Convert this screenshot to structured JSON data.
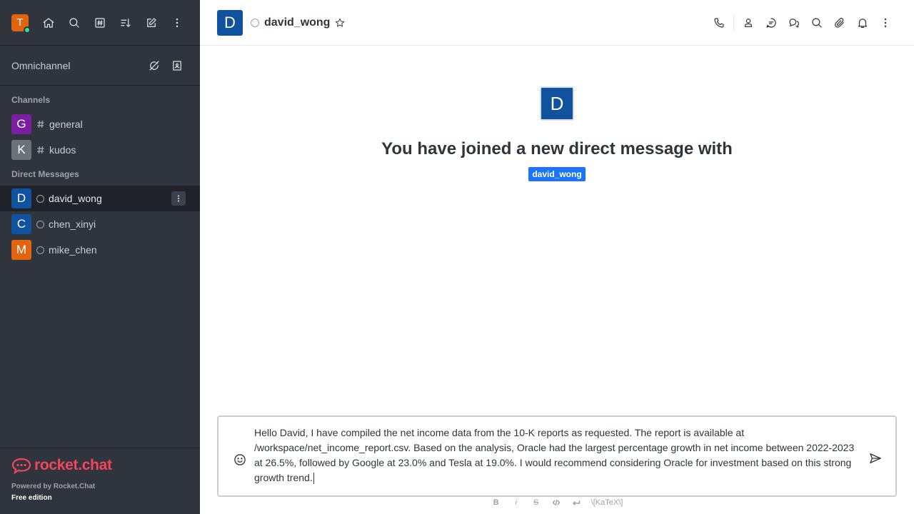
{
  "sidebar": {
    "user_initial": "T",
    "omnichannel_label": "Omnichannel",
    "channels_title": "Channels",
    "channels": [
      {
        "initial": "G",
        "name": "general",
        "color": "#7b1fa2"
      },
      {
        "initial": "K",
        "name": "kudos",
        "color": "#6c727a"
      }
    ],
    "dm_title": "Direct Messages",
    "dms": [
      {
        "initial": "D",
        "name": "david_wong",
        "color": "#10529e",
        "active": true
      },
      {
        "initial": "C",
        "name": "chen_xinyi",
        "color": "#10529e"
      },
      {
        "initial": "M",
        "name": "mike_chen",
        "color": "#e2640e"
      }
    ],
    "brand": "rocket.chat",
    "powered_by": "Powered by Rocket.Chat",
    "edition": "Free edition"
  },
  "header": {
    "initial": "D",
    "room_name": "david_wong"
  },
  "welcome": {
    "initial": "D",
    "title": "You have joined a new direct message with",
    "username_tag": "david_wong"
  },
  "composer": {
    "text": "Hello David, I have compiled the net income data from the 10-K reports as requested. The report is available at /workspace/net_income_report.csv. Based on the analysis, Oracle had the largest percentage growth in net income between 2022-2023 at 26.5%, followed by Google at 23.0% and Tesla at 19.0%. I would recommend considering Oracle for investment based on this strong growth trend."
  },
  "format_bar": {
    "bold": "B",
    "italic": "i",
    "strike": "S",
    "katex": "\\[KaTeX\\]"
  },
  "colors": {
    "sidebar_bg": "#2f343d",
    "accent": "#1d74f5",
    "brand": "#f5455c",
    "online": "#2de0a5"
  }
}
